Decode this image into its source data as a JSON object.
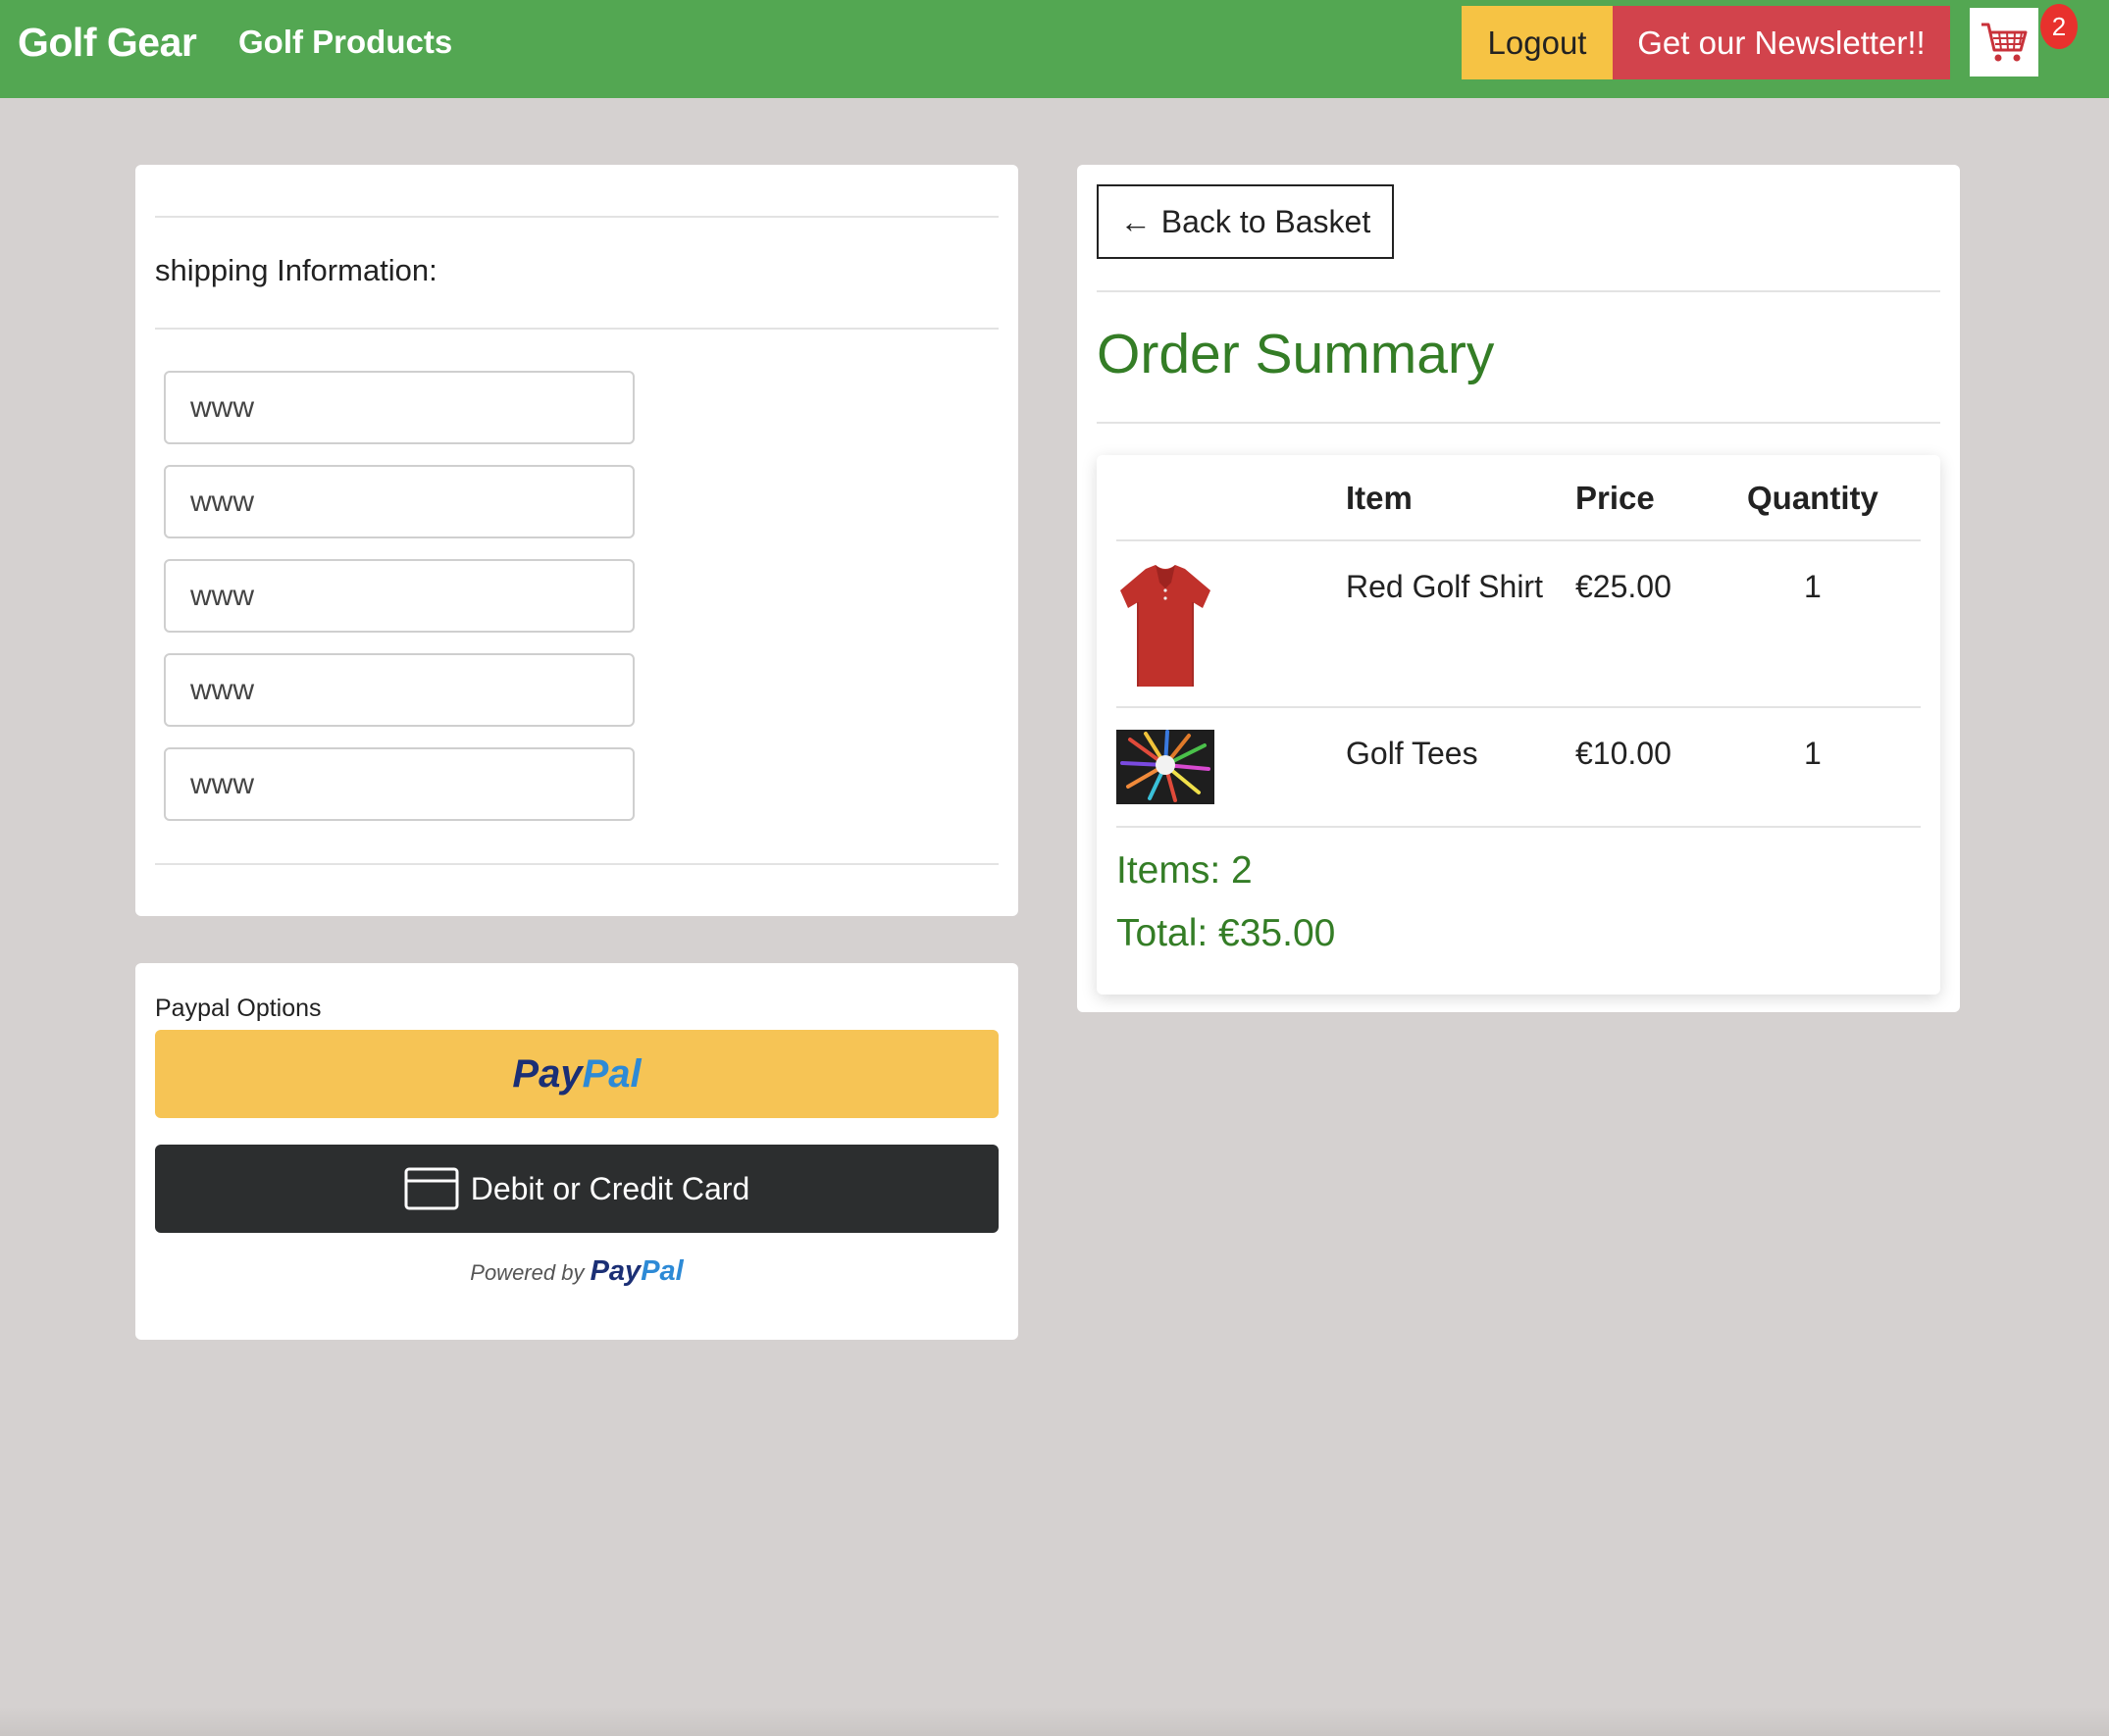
{
  "navbar": {
    "brand": "Golf Gear",
    "link": "Golf Products",
    "logout": "Logout",
    "newsletter": "Get our Newsletter!!",
    "cart_icon": "shopping-cart-icon",
    "cart_count": "2",
    "colors": {
      "bar": "#53a752",
      "logout": "#f6c344",
      "newsletter": "#d2434c",
      "badge": "#e8312d"
    }
  },
  "shipping": {
    "title": "shipping Information:",
    "fields": [
      {
        "value": "www"
      },
      {
        "value": "www"
      },
      {
        "value": "www"
      },
      {
        "value": "www"
      },
      {
        "value": "www"
      }
    ]
  },
  "paypal": {
    "label": "Paypal Options",
    "button_pay": "Pay",
    "button_pal": "Pal",
    "card_button": "Debit or Credit Card",
    "card_icon": "credit-card-icon",
    "powered_by": "Powered by",
    "powered_pay": "Pay",
    "powered_pal": "Pal"
  },
  "summary": {
    "back": "Back to Basket",
    "back_icon": "arrow-left-icon",
    "title": "Order Summary",
    "headers": {
      "item": "Item",
      "price": "Price",
      "quantity": "Quantity"
    },
    "rows": [
      {
        "item": "Red Golf Shirt",
        "price": "€25.00",
        "quantity": "1",
        "image": "red-golf-shirt-image"
      },
      {
        "item": "Golf Tees",
        "price": "€10.00",
        "quantity": "1",
        "image": "golf-tees-image"
      }
    ],
    "items_total": "Items: 2",
    "total": "Total: €35.00",
    "accent": "#347d26"
  }
}
